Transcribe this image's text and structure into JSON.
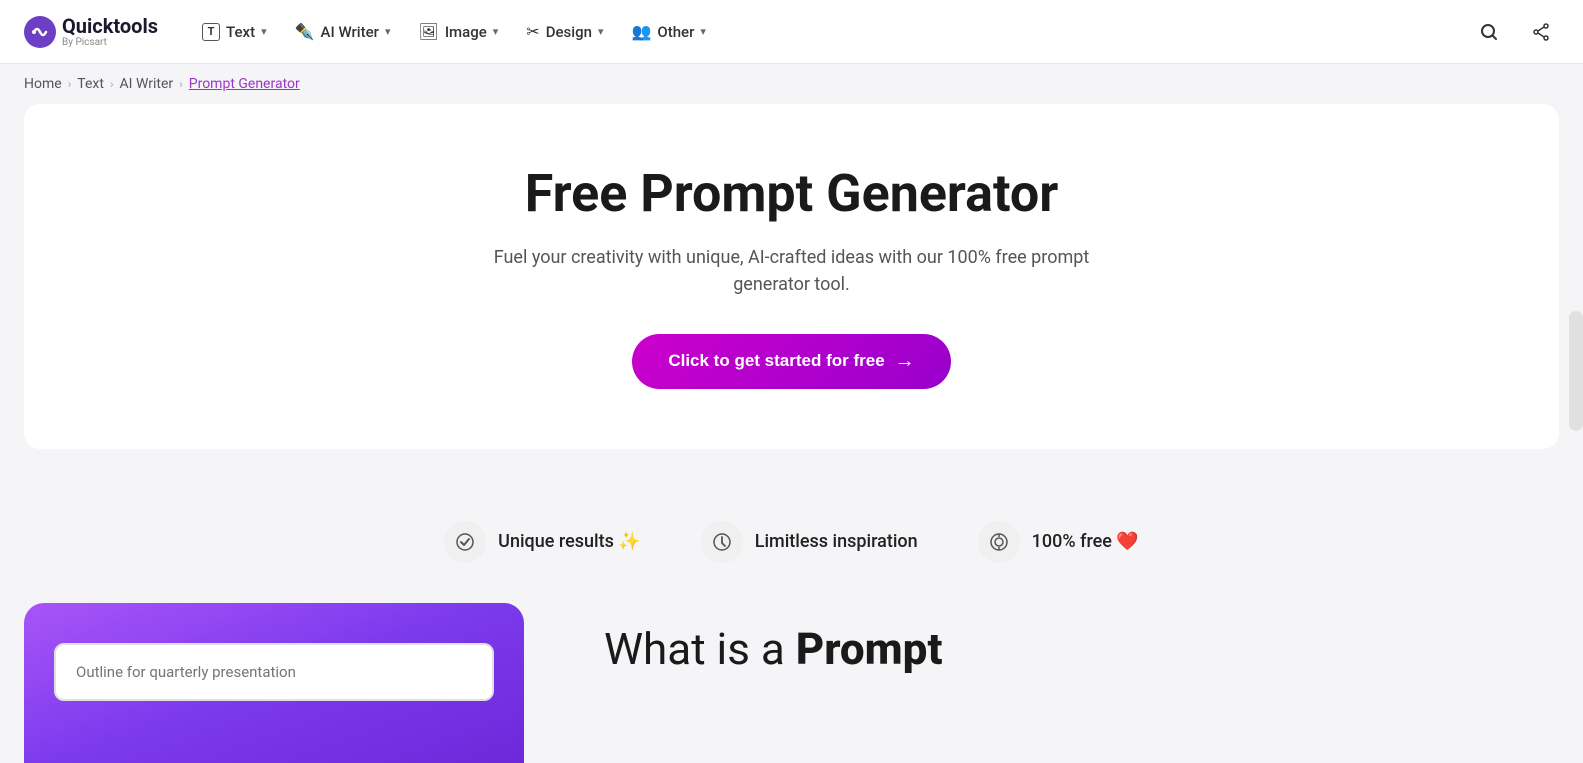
{
  "logo": {
    "name": "Quicktools",
    "sub": "By Picsart",
    "icon": "🔵"
  },
  "nav": {
    "items": [
      {
        "id": "text",
        "icon": "T",
        "icon_type": "text-icon",
        "label": "Text",
        "has_dropdown": true
      },
      {
        "id": "ai-writer",
        "icon": "✏️",
        "icon_type": "ai-writer-icon",
        "label": "AI Writer",
        "has_dropdown": true
      },
      {
        "id": "image",
        "icon": "🖼️",
        "icon_type": "image-icon",
        "label": "Image",
        "has_dropdown": true
      },
      {
        "id": "design",
        "icon": "✂️",
        "icon_type": "design-icon",
        "label": "Design",
        "has_dropdown": true
      },
      {
        "id": "other",
        "icon": "👤",
        "icon_type": "other-icon",
        "label": "Other",
        "has_dropdown": true
      }
    ],
    "search_icon": "🔍",
    "share_icon": "↗"
  },
  "breadcrumb": {
    "items": [
      {
        "label": "Home",
        "link": true
      },
      {
        "label": "Text",
        "link": true
      },
      {
        "label": "AI Writer",
        "link": true
      },
      {
        "label": "Prompt Generator",
        "link": false,
        "current": true
      }
    ]
  },
  "hero": {
    "title": "Free Prompt Generator",
    "subtitle": "Fuel your creativity with unique, AI-crafted ideas with our 100% free prompt generator tool.",
    "cta_label": "Click to get started for free",
    "cta_arrow": "→"
  },
  "features": [
    {
      "id": "unique-results",
      "icon": "✓",
      "label": "Unique results ✨"
    },
    {
      "id": "limitless-inspiration",
      "icon": "⏱",
      "label": "Limitless inspiration"
    },
    {
      "id": "free",
      "icon": "◎",
      "label": "100% free ❤️"
    }
  ],
  "bottom": {
    "input_placeholder": "Outline for quarterly presentation",
    "what_is_prefix": "What is a ",
    "what_is_bold": "Prompt"
  },
  "colors": {
    "cta_bg_start": "#cc00cc",
    "cta_bg_end": "#9900cc",
    "brand_purple": "#9b35c8",
    "gradient_start": "#a855f7",
    "gradient_end": "#6d28d9"
  }
}
